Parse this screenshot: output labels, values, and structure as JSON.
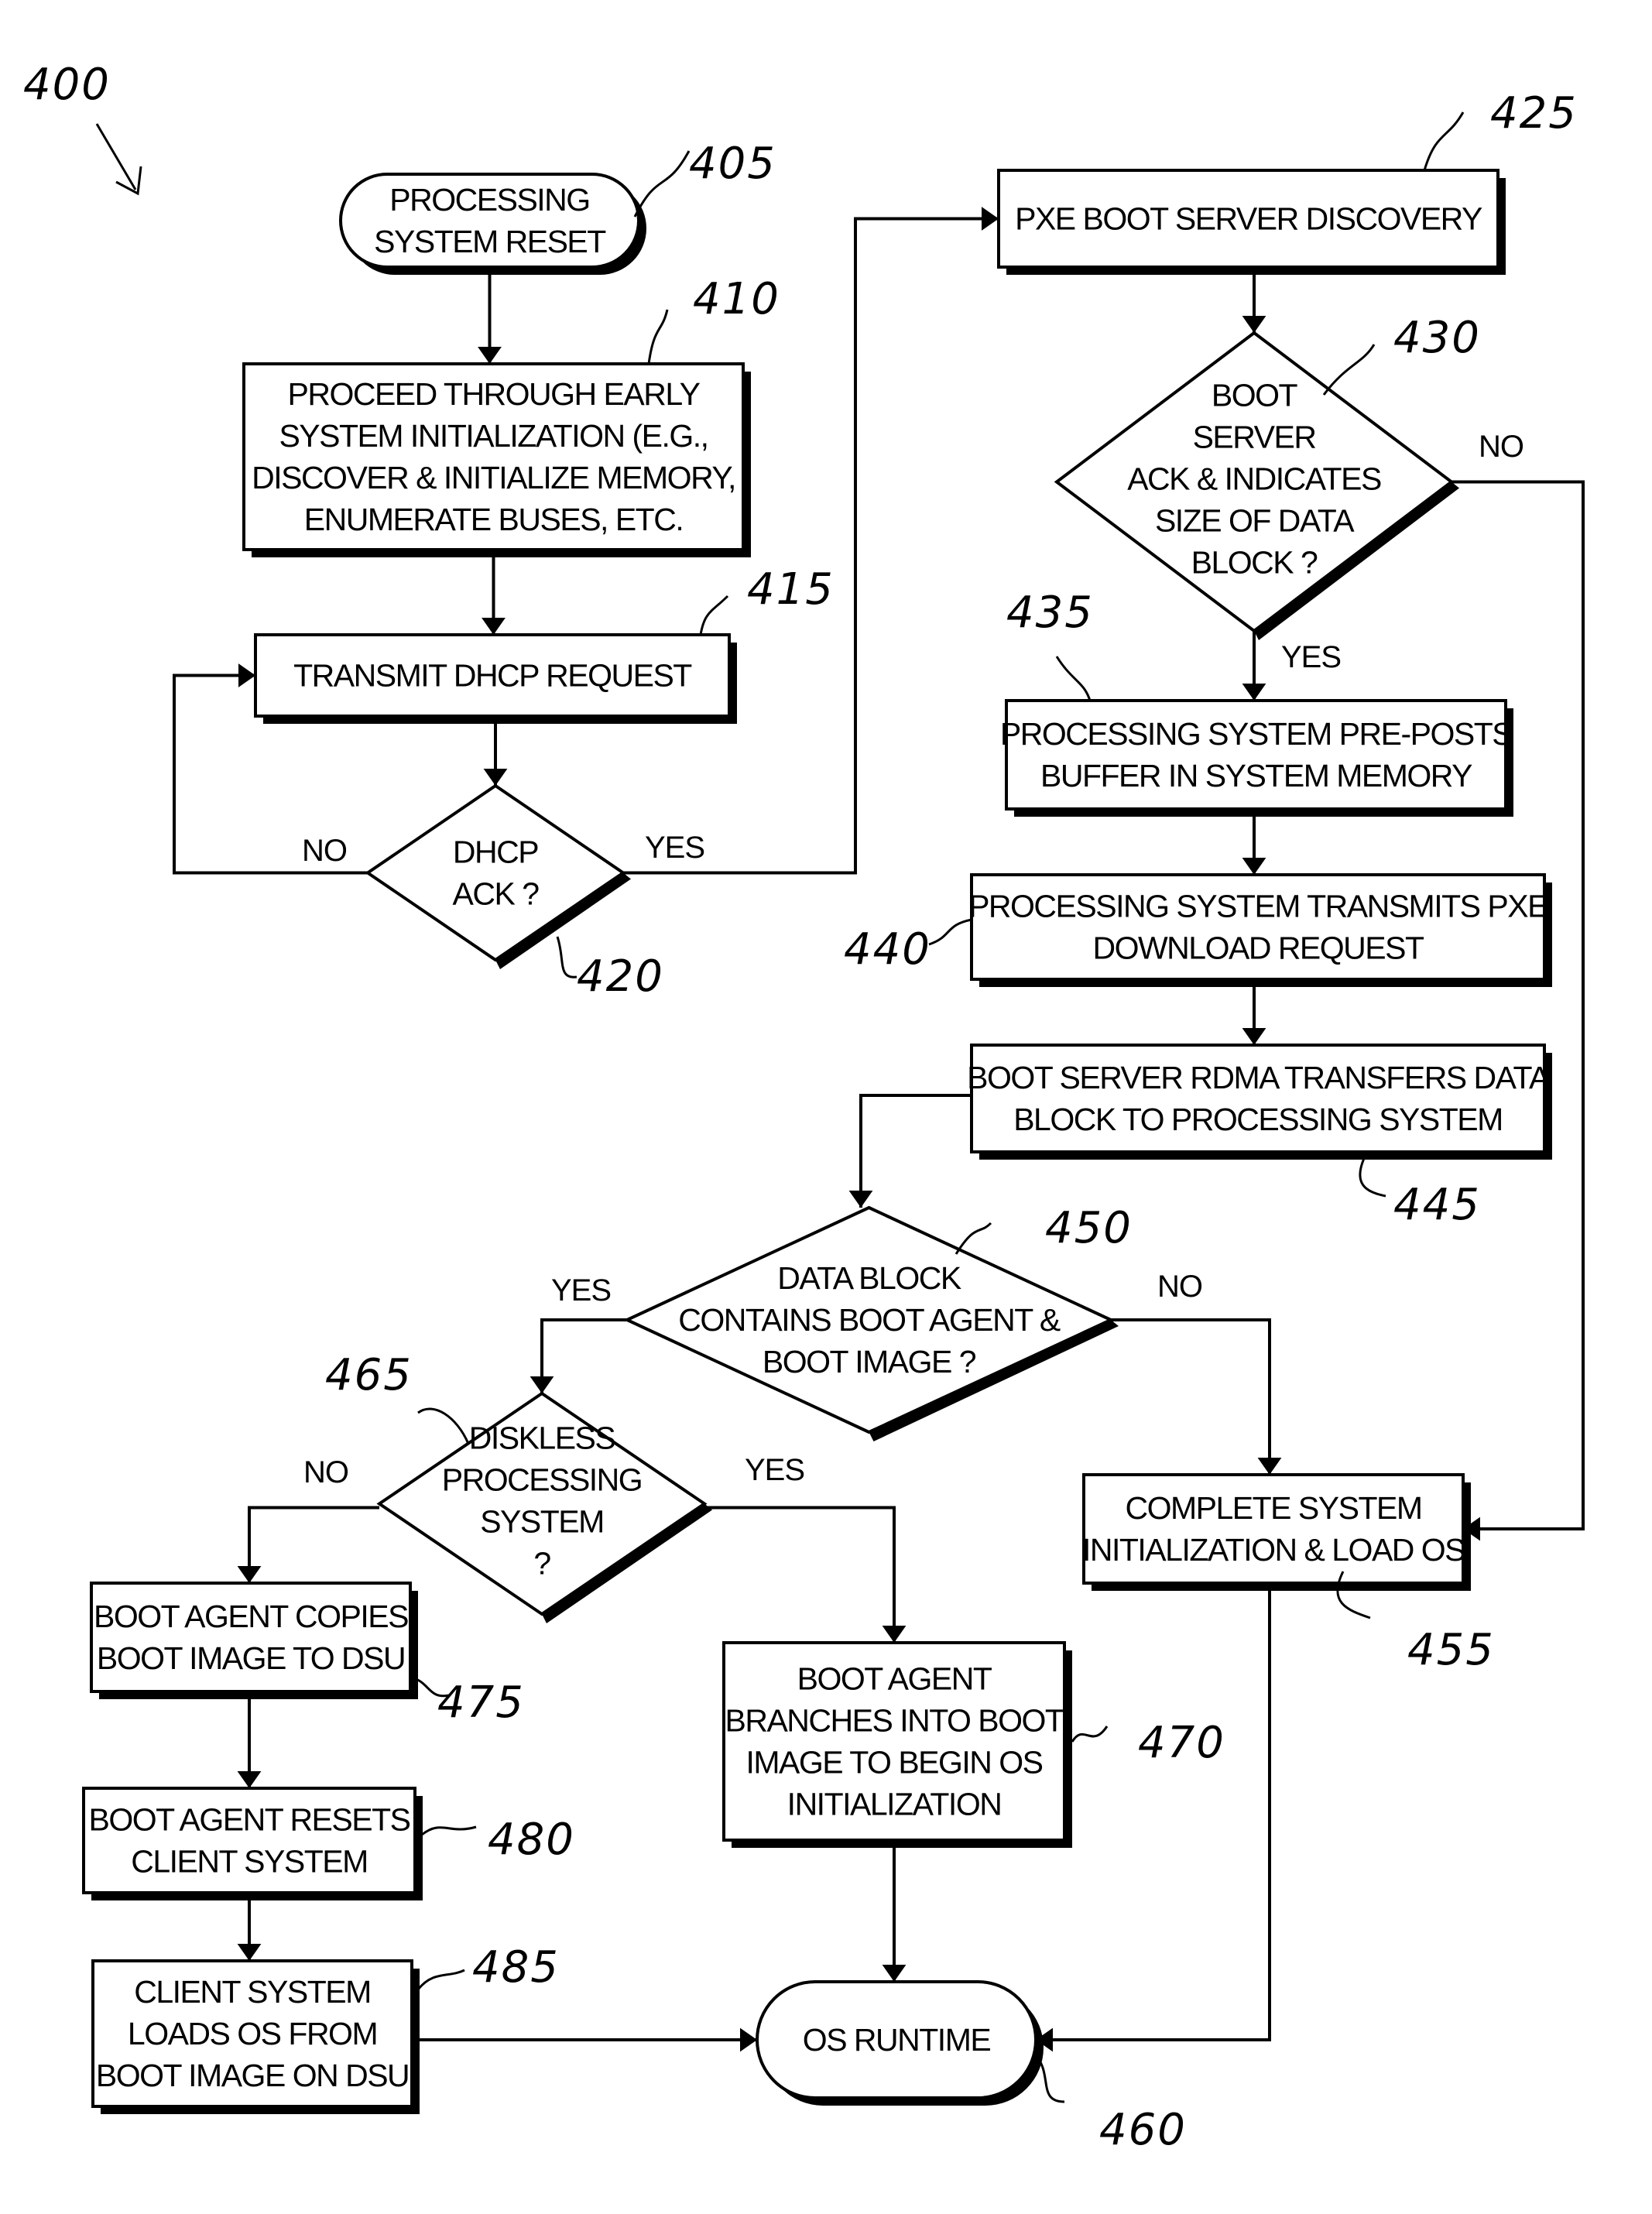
{
  "figure": {
    "ref": "400",
    "nodes": [
      {
        "id": "405",
        "type": "terminator",
        "lines": [
          "PROCESSING",
          "SYSTEM RESET"
        ]
      },
      {
        "id": "410",
        "type": "process",
        "lines": [
          "PROCEED THROUGH EARLY",
          "SYSTEM INITIALIZATION (E.G.,",
          "DISCOVER & INITIALIZE MEMORY,",
          "ENUMERATE BUSES, ETC."
        ]
      },
      {
        "id": "415",
        "type": "process",
        "lines": [
          "TRANSMIT DHCP REQUEST"
        ]
      },
      {
        "id": "420",
        "type": "decision",
        "lines": [
          "DHCP",
          "ACK ?"
        ]
      },
      {
        "id": "425",
        "type": "process",
        "lines": [
          "PXE BOOT SERVER DISCOVERY"
        ]
      },
      {
        "id": "430",
        "type": "decision",
        "lines": [
          "BOOT",
          "SERVER",
          "ACK & INDICATES",
          "SIZE OF DATA",
          "BLOCK ?"
        ]
      },
      {
        "id": "435",
        "type": "process",
        "lines": [
          "PROCESSING SYSTEM PRE-POSTS",
          "BUFFER IN SYSTEM MEMORY"
        ]
      },
      {
        "id": "440",
        "type": "process",
        "lines": [
          "PROCESSING SYSTEM TRANSMITS PXE",
          "DOWNLOAD REQUEST"
        ]
      },
      {
        "id": "445",
        "type": "process",
        "lines": [
          "BOOT SERVER RDMA TRANSFERS DATA",
          "BLOCK TO PROCESSING SYSTEM"
        ]
      },
      {
        "id": "450",
        "type": "decision",
        "lines": [
          "DATA BLOCK",
          "CONTAINS BOOT AGENT &",
          "BOOT IMAGE ?"
        ]
      },
      {
        "id": "455",
        "type": "process",
        "lines": [
          "COMPLETE SYSTEM",
          "INITIALIZATION & LOAD OS"
        ]
      },
      {
        "id": "460",
        "type": "terminator",
        "lines": [
          "OS RUNTIME"
        ]
      },
      {
        "id": "465",
        "type": "decision",
        "lines": [
          "DISKLESS",
          "PROCESSING",
          "SYSTEM",
          "?"
        ]
      },
      {
        "id": "470",
        "type": "process",
        "lines": [
          "BOOT AGENT",
          "BRANCHES INTO BOOT",
          "IMAGE TO BEGIN OS",
          "INITIALIZATION"
        ]
      },
      {
        "id": "475",
        "type": "process",
        "lines": [
          "BOOT AGENT COPIES",
          "BOOT IMAGE TO DSU"
        ]
      },
      {
        "id": "480",
        "type": "process",
        "lines": [
          "BOOT AGENT RESETS",
          "CLIENT SYSTEM"
        ]
      },
      {
        "id": "485",
        "type": "process",
        "lines": [
          "CLIENT SYSTEM",
          "LOADS OS FROM",
          "BOOT IMAGE ON DSU"
        ]
      }
    ],
    "edges": [
      {
        "from": "405",
        "to": "410",
        "label": ""
      },
      {
        "from": "410",
        "to": "415",
        "label": ""
      },
      {
        "from": "415",
        "to": "420",
        "label": ""
      },
      {
        "from": "420",
        "to": "415",
        "label": "NO"
      },
      {
        "from": "420",
        "to": "425",
        "label": "YES"
      },
      {
        "from": "425",
        "to": "430",
        "label": ""
      },
      {
        "from": "430",
        "to": "435",
        "label": "YES"
      },
      {
        "from": "430",
        "to": "455",
        "label": "NO"
      },
      {
        "from": "435",
        "to": "440",
        "label": ""
      },
      {
        "from": "440",
        "to": "445",
        "label": ""
      },
      {
        "from": "445",
        "to": "450",
        "label": ""
      },
      {
        "from": "450",
        "to": "465",
        "label": "YES"
      },
      {
        "from": "450",
        "to": "455",
        "label": "NO"
      },
      {
        "from": "465",
        "to": "475",
        "label": "NO"
      },
      {
        "from": "465",
        "to": "470",
        "label": "YES"
      },
      {
        "from": "475",
        "to": "480",
        "label": ""
      },
      {
        "from": "480",
        "to": "485",
        "label": ""
      },
      {
        "from": "485",
        "to": "460",
        "label": ""
      },
      {
        "from": "470",
        "to": "460",
        "label": ""
      },
      {
        "from": "455",
        "to": "460",
        "label": ""
      }
    ],
    "branch_labels": {
      "no": "NO",
      "yes": "YES"
    }
  }
}
